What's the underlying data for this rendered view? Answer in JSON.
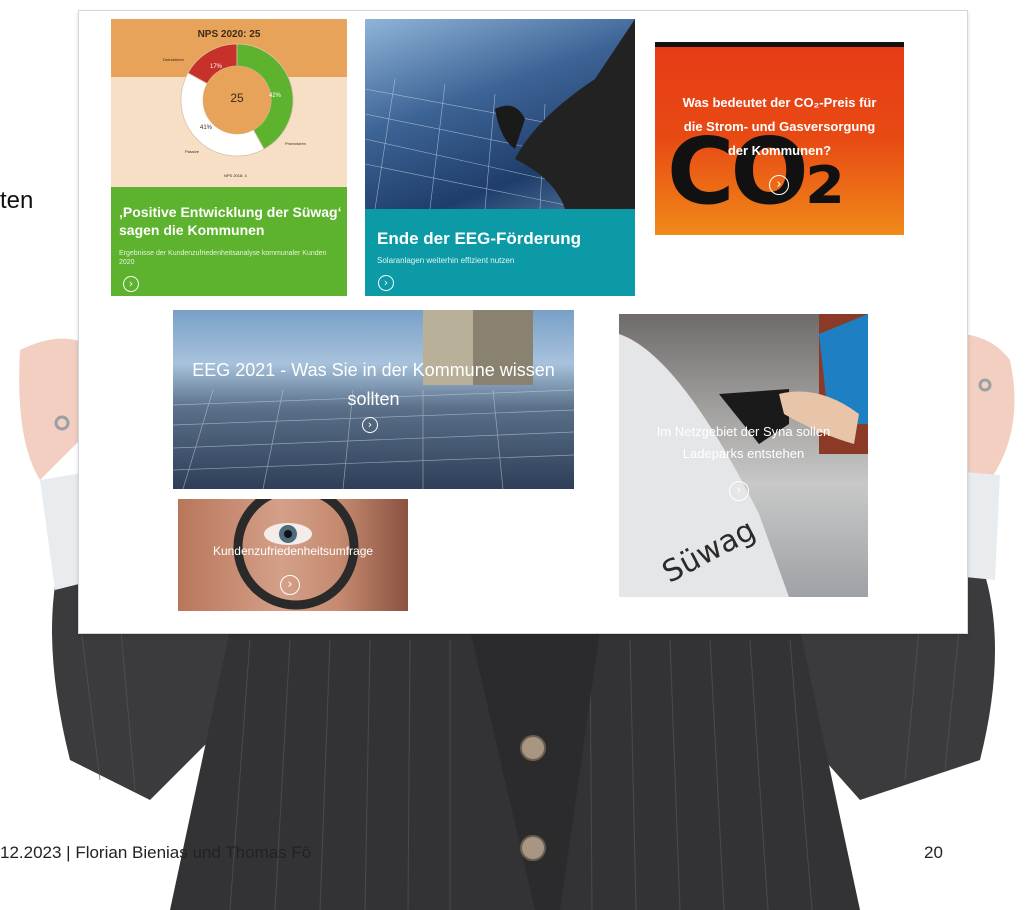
{
  "slide": {
    "stray_text": "ten",
    "footer_text": "12.2023 | Florian Bienias und Thomas Fö",
    "page_number": "20"
  },
  "tiles": {
    "nps": {
      "chart_title": "NPS 2020: 25",
      "center_value": "25",
      "label_detraktoren": "Detraktoren",
      "label_promotoren": "Promotoren",
      "label_passive": "Passive",
      "pct_detraktoren": "17%",
      "pct_promotoren": "42%",
      "pct_passive": "41%",
      "nps_2018": "NPS 2018: 4",
      "title": "‚Positive Entwicklung der Süwag‘ sagen die Kommunen",
      "subtitle": "Ergebnisse der Kundenzufriedenheitsanalyse kommunaler Kunden 2020",
      "bg_top": "#e8a35a",
      "bg_bottom": "#5db22e"
    },
    "eeg_end": {
      "title": "Ende der EEG-Förderung",
      "subtitle": "Solaranlagen weiterhin effizient nutzen",
      "bg": "#0c9aa6"
    },
    "co2": {
      "title_line1": "Was bedeutet der CO₂-Preis für",
      "title_line2": "die Strom- und Gasversorgung",
      "title_line3": "der Kommunen?",
      "big_text": "CO₂"
    },
    "eeg2021": {
      "title_line1": "EEG 2021 - Was Sie in der Kommune wissen",
      "title_line2": "sollten"
    },
    "syna": {
      "title_line1": "Im Netzgebiet der Syna sollen",
      "title_line2": "Ladeparks entstehen",
      "brand": "Süwag"
    },
    "survey": {
      "title": "Kundenzufriedenheitsumfrage"
    }
  },
  "chart_data": {
    "type": "pie",
    "title": "NPS 2020: 25",
    "categories": [
      "Detraktoren",
      "Promotoren",
      "Passive"
    ],
    "values": [
      17,
      42,
      41
    ],
    "colors": [
      "#c8302a",
      "#5db22e",
      "#ffffff"
    ]
  },
  "icons": {
    "arrow": "›"
  }
}
